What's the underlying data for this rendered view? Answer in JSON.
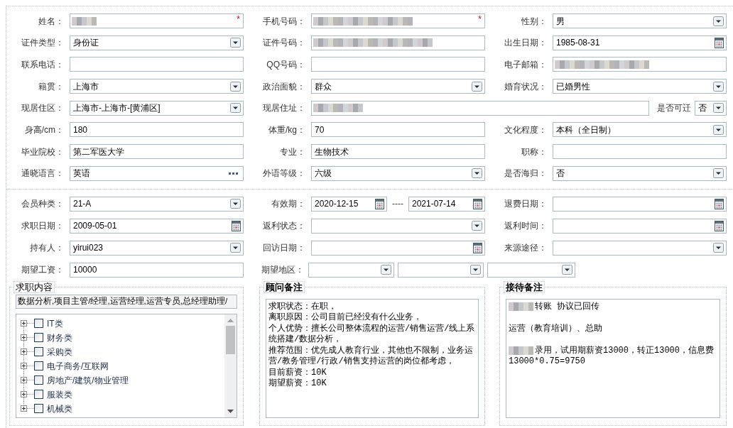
{
  "basic_info": {
    "rows": [
      [
        {
          "label": "姓名：",
          "kind": "text",
          "redacted": true,
          "required_mark": "*"
        },
        {
          "label": "手机号码：",
          "kind": "text",
          "redacted": true,
          "required_mark": "*"
        },
        {
          "label": "性别：",
          "kind": "select",
          "value": "男"
        }
      ],
      [
        {
          "label": "证件类型：",
          "kind": "select",
          "value": "身份证"
        },
        {
          "label": "证件号码：",
          "kind": "text",
          "redacted": true
        },
        {
          "label": "出生日期：",
          "kind": "date",
          "value": "1985-08-31"
        }
      ],
      [
        {
          "label": "联系电话：",
          "kind": "text"
        },
        {
          "label": "QQ号码：",
          "kind": "text"
        },
        {
          "label": "电子邮箱：",
          "kind": "text",
          "redacted": true
        }
      ],
      [
        {
          "label": "籍贯：",
          "kind": "select",
          "value": "上海市"
        },
        {
          "label": "政治面貌：",
          "kind": "select",
          "value": "群众"
        },
        {
          "label": "婚育状况：",
          "kind": "select",
          "value": "已婚男性"
        }
      ],
      [
        {
          "label": "现居住区：",
          "kind": "select",
          "value": "上海市-上海市-[黄浦区]"
        },
        {
          "label": "现居住址：",
          "kind": "wide_text",
          "redacted": true
        },
        {
          "label": "是否可迁",
          "kind": "mini_select",
          "value": "否"
        }
      ],
      [
        {
          "label": "身高/cm：",
          "kind": "text",
          "value": "180"
        },
        {
          "label": "体重/kg：",
          "kind": "text",
          "value": "70"
        },
        {
          "label": "文化程度：",
          "kind": "select",
          "value": "本科（全日制）"
        }
      ],
      [
        {
          "label": "毕业院校：",
          "kind": "text",
          "value": "第二军医大学"
        },
        {
          "label": "专业：",
          "kind": "text",
          "value": "生物技术"
        },
        {
          "label": "职称：",
          "kind": "text"
        }
      ],
      [
        {
          "label": "通晓语言：",
          "kind": "lookup",
          "value": "英语"
        },
        {
          "label": "外语等级：",
          "kind": "select",
          "value": "六级"
        },
        {
          "label": "是否海归：",
          "kind": "select",
          "value": "否"
        }
      ]
    ]
  },
  "membership": {
    "rows": [
      [
        {
          "label": "会员种类：",
          "kind": "select",
          "value": "21-A"
        },
        {
          "label": "有效期：",
          "kind": "date_range",
          "from": "2020-12-15",
          "separator": "----",
          "to": "2021-07-14"
        },
        {
          "label": "退费日期：",
          "kind": "date"
        }
      ],
      [
        {
          "label": "求职日期：",
          "kind": "date",
          "value": "2009-05-01"
        },
        {
          "label": "返利状态：",
          "kind": "select"
        },
        {
          "label": "返利时间：",
          "kind": "date"
        }
      ],
      [
        {
          "label": "持有人：",
          "kind": "select",
          "value": "yirui023"
        },
        {
          "label": "回访日期：",
          "kind": "date"
        },
        {
          "label": "来源途径：",
          "kind": "select"
        }
      ],
      [
        {
          "label": "期望工资：",
          "kind": "text",
          "value": "10000"
        },
        {
          "label": "期望地区：",
          "kind": "select_group",
          "parts": [
            {
              "kind": "select"
            },
            {
              "kind": "select"
            },
            {
              "kind": "select"
            }
          ]
        }
      ]
    ]
  },
  "job_intent": {
    "legend": "求职内容",
    "summary": "数据分析,项目主管/经理,运营经理,运营专员,总经理助理/",
    "categories": [
      {
        "label": "IT类",
        "expanded": false,
        "checked": false
      },
      {
        "label": "财务类",
        "expanded": false,
        "checked": false
      },
      {
        "label": "采购类",
        "expanded": false,
        "checked": false
      },
      {
        "label": "电子商务/互联网",
        "expanded": false,
        "checked": false
      },
      {
        "label": "房地产/建筑/物业管理",
        "expanded": false,
        "checked": false
      },
      {
        "label": "服装类",
        "expanded": false,
        "checked": false
      },
      {
        "label": "机械类",
        "expanded": false,
        "checked": false
      }
    ]
  },
  "consultant_notes": {
    "legend": "顾问备注",
    "lines": [
      "求职状态：在职，",
      "离职原因：公司目前已经没有什么业务，",
      "个人优势：擅长公司整体流程的运营/销售运营/线上系统搭建/数据分析，",
      "推荐范围：优先成人教育行业，其他也不限制，业务运营/教务管理/行政/销售支持运营的岗位都考虑，",
      "目前薪资：10K",
      "期望薪资：10K"
    ]
  },
  "reception_notes": {
    "legend": "接待备注",
    "paragraphs": [
      {
        "text": "转账 协议已回传",
        "redacted_prefix": true
      },
      {
        "text": "运营（教育培训）、总助",
        "redacted_prefix": false
      },
      {
        "text": "录用，试用期薪资13000，转正13000，信息费13000*0.75=9750",
        "redacted_prefix": true
      }
    ]
  }
}
